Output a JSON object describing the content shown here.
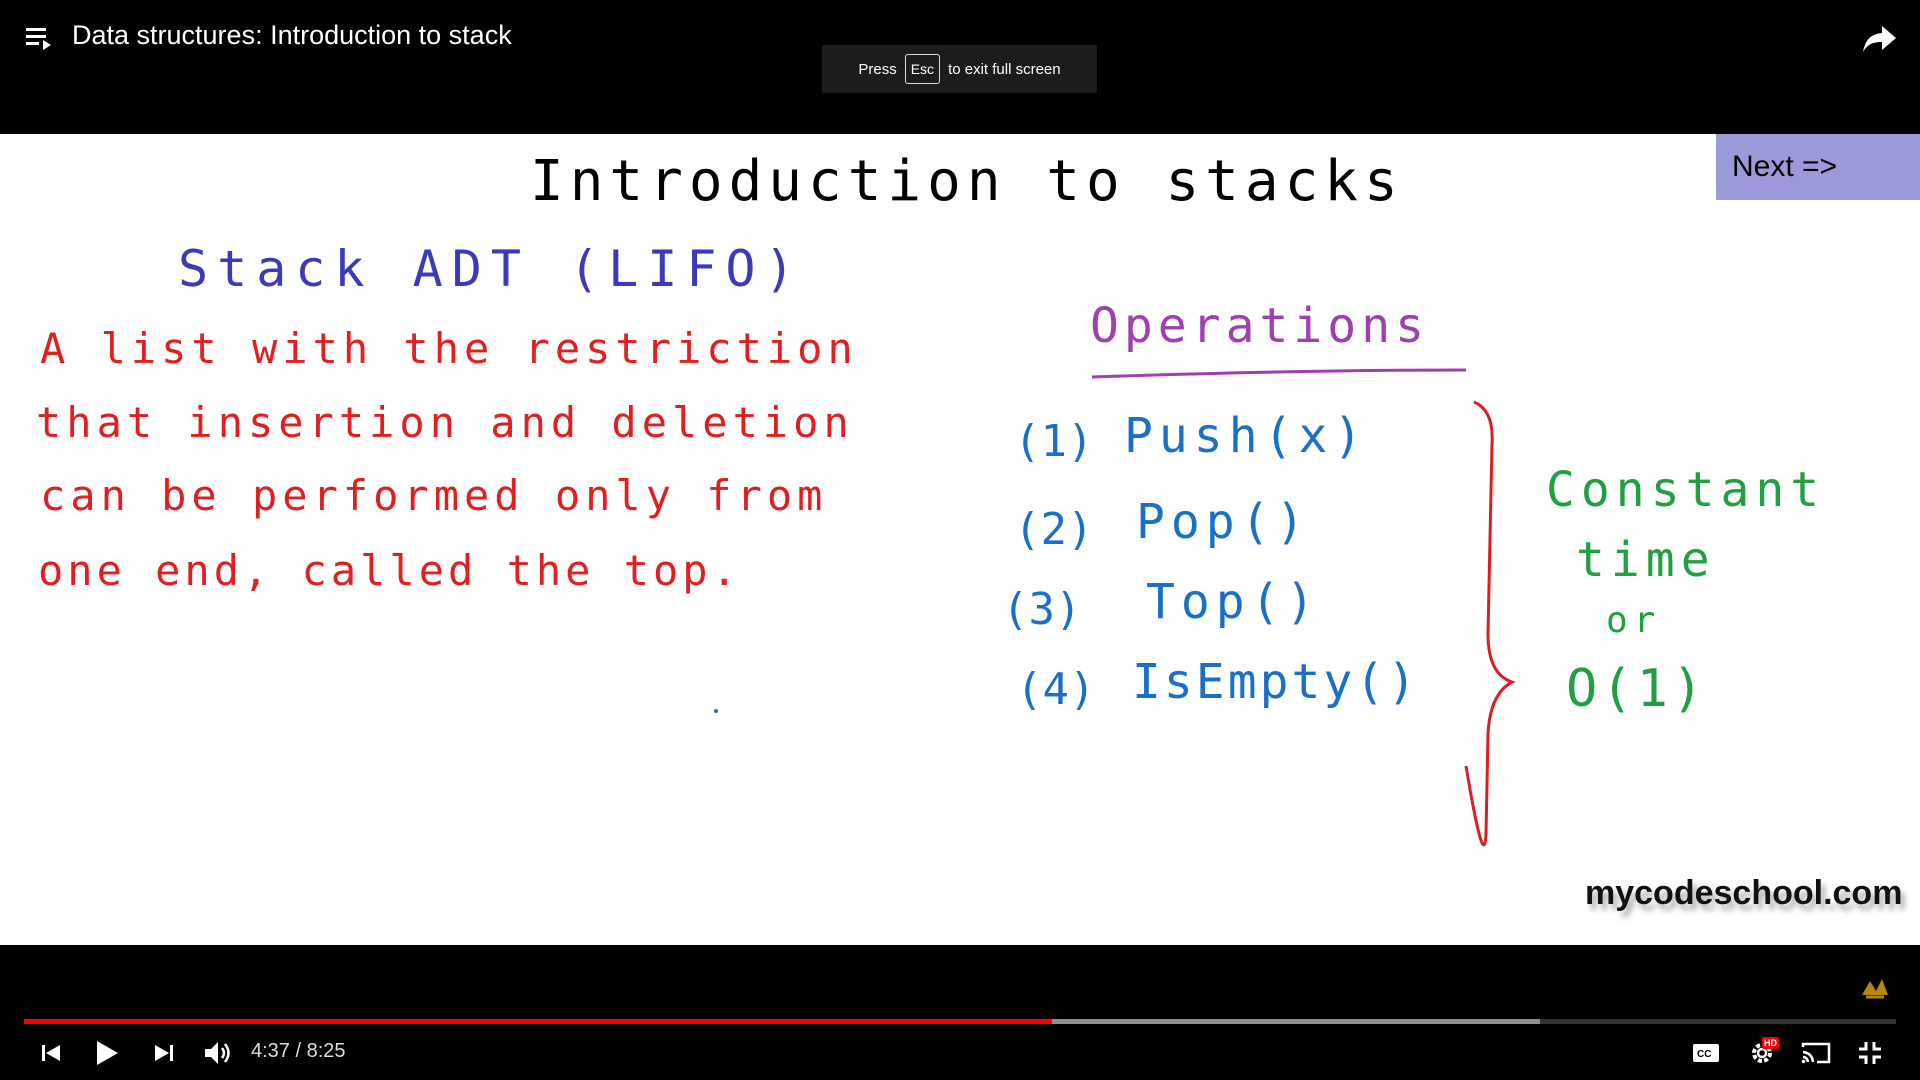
{
  "header": {
    "title": "Data structures: Introduction to stack",
    "playlist_icon": "playlist-icon",
    "share_icon": "share-icon"
  },
  "esc_toast": {
    "before": "Press",
    "key": "Esc",
    "after": "to exit full screen"
  },
  "board": {
    "heading": "Introduction to stacks",
    "subheading": "Stack ADT (LIFO)",
    "definition_lines": [
      "A list with the restriction",
      "that insertion and deletion",
      "can be performed only from",
      "one end, called the top."
    ],
    "operations_heading": "Operations",
    "operations": [
      {
        "num": "(1)",
        "name": "Push(x)"
      },
      {
        "num": "(2)",
        "name": "Pop()"
      },
      {
        "num": "(3)",
        "name": "Top()"
      },
      {
        "num": "(4)",
        "name": "IsEmpty()"
      }
    ],
    "complexity_lines": [
      "Constant",
      "time",
      "or",
      "O(1)"
    ],
    "next_button": "Next =>",
    "watermark": "mycodeschool.com",
    "colors": {
      "heading": "#000000",
      "subheading": "#3a3aba",
      "definition": "#e02020",
      "operations_heading": "#a040b0",
      "operations": "#1a70c8",
      "brace": "#d82020",
      "complexity": "#20a040",
      "next_bg": "#9a9ad8"
    }
  },
  "controls": {
    "current_time": "4:37",
    "duration": "8:25",
    "played_fraction": 0.549,
    "loaded_fraction": 0.81,
    "icons": [
      "previous-icon",
      "play-icon",
      "next-icon",
      "volume-icon",
      "captions-icon",
      "settings-icon",
      "cast-icon",
      "exit-fullscreen-icon"
    ],
    "hd_badge": "HD"
  }
}
